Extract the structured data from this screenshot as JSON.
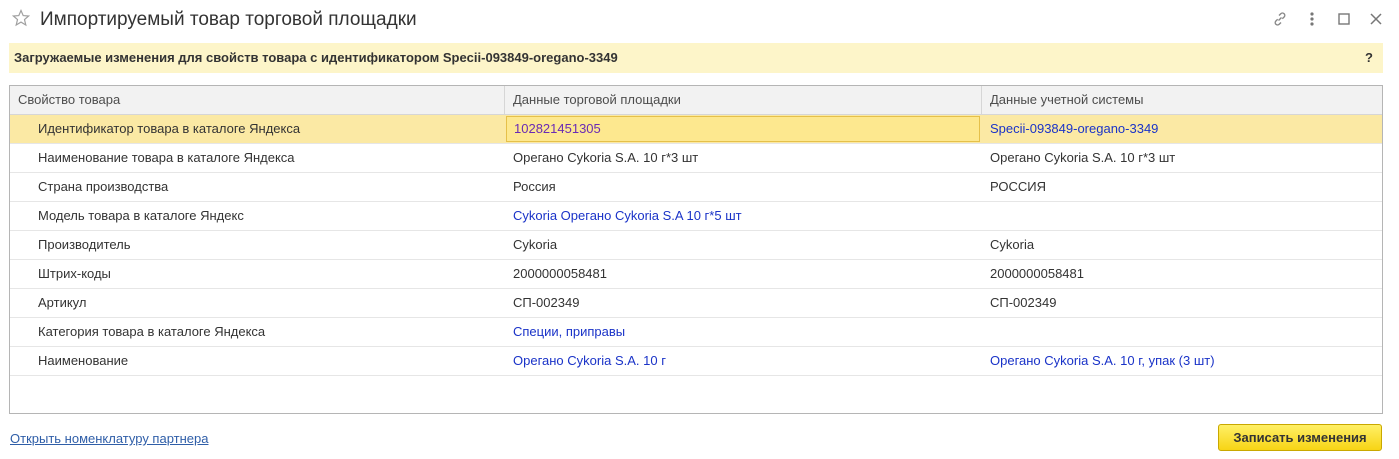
{
  "window": {
    "title": "Импортируемый товар торговой площадки"
  },
  "banner": {
    "text": "Загружаемые изменения для свойств товара с идентификатором Specii-093849-oregano-3349",
    "help": "?"
  },
  "table": {
    "columns": [
      "Свойство товара",
      "Данные торговой площадки",
      "Данные учетной системы"
    ],
    "rows": [
      {
        "property": "Идентификатор товара в каталоге Яндекса",
        "marketplace": "102821451305",
        "accounting": "Specii-093849-oregano-3349"
      },
      {
        "property": "Наименование товара в каталоге Яндекса",
        "marketplace": "Орегано Cykoria S.A. 10 г*3 шт",
        "accounting": "Орегано Cykoria S.A. 10 г*3 шт"
      },
      {
        "property": "Страна производства",
        "marketplace": "Россия",
        "accounting": "РОССИЯ"
      },
      {
        "property": "Модель товара в каталоге Яндекс",
        "marketplace": "Cykoria Орегано Cykoria S.A 10 г*5 шт",
        "accounting": ""
      },
      {
        "property": "Производитель",
        "marketplace": "Cykoria",
        "accounting": "Cykoria"
      },
      {
        "property": "Штрих-коды",
        "marketplace": "2000000058481",
        "accounting": "2000000058481"
      },
      {
        "property": "Артикул",
        "marketplace": "СП-002349",
        "accounting": "СП-002349"
      },
      {
        "property": "Категория товара в каталоге Яндекса",
        "marketplace": "Специи, приправы",
        "accounting": ""
      },
      {
        "property": "Наименование",
        "marketplace": "Орегано Cykoria S.A. 10 г",
        "accounting": "Орегано Cykoria S.A. 10 г, упак (3 шт)"
      }
    ]
  },
  "footer": {
    "link": "Открыть номенклатуру партнера",
    "save_button": "Записать изменения"
  },
  "colors": {
    "selected_row": "#fbe9a4",
    "banner_bg": "#fdf5c9",
    "link": "#1a33c8",
    "button": "#f7d415"
  }
}
